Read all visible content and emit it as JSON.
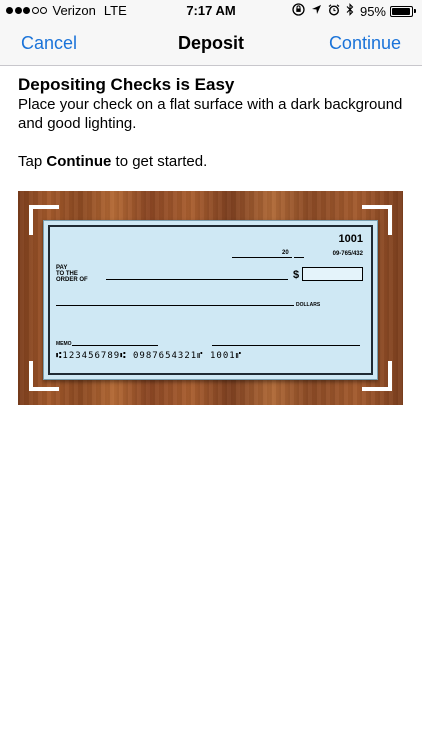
{
  "status_bar": {
    "carrier": "Verizon",
    "network": "LTE",
    "time": "7:17 AM",
    "battery_percent_label": "95%",
    "battery_level": 0.95,
    "signal_bars_filled": 3,
    "signal_bars_total": 5,
    "icons": [
      "rotation-lock-icon",
      "location-arrow-icon",
      "alarm-icon",
      "bluetooth-icon",
      "battery-icon"
    ]
  },
  "nav": {
    "cancel_label": "Cancel",
    "title": "Deposit",
    "continue_label": "Continue",
    "accent_color": "#1a73d9"
  },
  "content": {
    "heading": "Depositing Checks is Easy",
    "description": "Place your check on a flat surface with a dark background and good lighting.",
    "tap_prefix": "Tap ",
    "tap_bold": "Continue",
    "tap_suffix": " to get started."
  },
  "check": {
    "number": "1001",
    "routing_fraction": "09-765/432",
    "date_prefix": "20",
    "pay_label_1": "PAY",
    "pay_label_2": "TO THE",
    "pay_label_3": "ORDER OF",
    "dollar_sign": "$",
    "dollars_label": "DOLLARS",
    "memo_label": "MEMO",
    "micr_line": "⑆123456789⑆  0987654321⑈  1001⑈"
  }
}
